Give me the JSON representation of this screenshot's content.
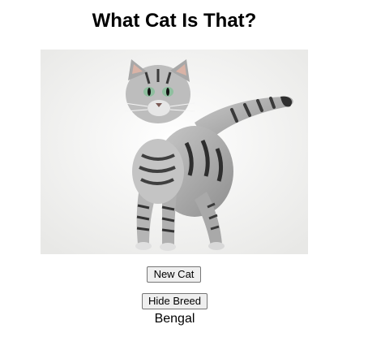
{
  "page": {
    "title": "What Cat Is That?"
  },
  "image": {
    "subject": "cat-photo"
  },
  "controls": {
    "new_cat_label": "New Cat",
    "hide_breed_label": "Hide Breed"
  },
  "result": {
    "breed": "Bengal"
  }
}
